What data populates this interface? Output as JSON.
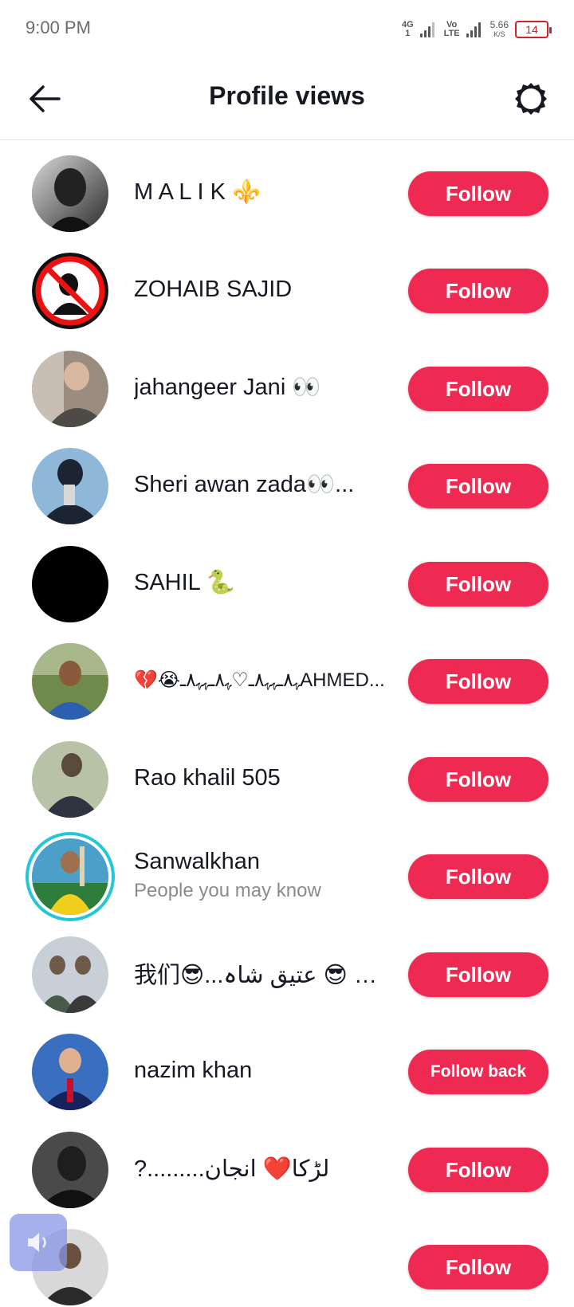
{
  "status_bar": {
    "time": "9:00 PM",
    "network_1": "4G",
    "network_1_sub": "1",
    "network_2": "Vo",
    "network_2_sub": "LTE",
    "speed_value": "5.66",
    "speed_unit": "K/S",
    "battery": "14",
    "battery_color": "#d32029"
  },
  "header": {
    "title": "Profile views",
    "back_icon": "arrow-left-icon",
    "settings_icon": "gear-icon"
  },
  "colors": {
    "follow_button": "#ee2a52",
    "story_ring": "#25c6d6"
  },
  "rows": [
    {
      "name": "M A L I K ⚜️",
      "subtitle": "",
      "button": "Follow"
    },
    {
      "name": "ZOHAIB SAJID",
      "subtitle": "",
      "button": "Follow"
    },
    {
      "name": "jahangeer Jani 👀",
      "subtitle": "",
      "button": "Follow"
    },
    {
      "name": "Sheri awan zada👀...",
      "subtitle": "",
      "button": "Follow"
    },
    {
      "name": "SAHIL 🐍",
      "subtitle": "",
      "button": "Follow"
    },
    {
      "name": "💔😭ﮩ٨ـﮩﮩ٨ـ♡ﮩ٨ـﮩﮩ٨ـAHMED...",
      "subtitle": "",
      "button": "Follow"
    },
    {
      "name": "Rao khalil 505",
      "subtitle": "",
      "button": "Follow"
    },
    {
      "name": "Sanwalkhan",
      "subtitle": "People you may know",
      "button": "Follow"
    },
    {
      "name": "我们😎...ملت 😎 عتیق شاہ",
      "subtitle": "",
      "button": "Follow"
    },
    {
      "name": "nazim khan",
      "subtitle": "",
      "button": "Follow back"
    },
    {
      "name": "?.........لڑکا❤️ انجان",
      "subtitle": "",
      "button": "Follow"
    },
    {
      "name": "",
      "subtitle": "",
      "button": "Follow"
    }
  ],
  "floating_button_icon": "speaker-icon"
}
